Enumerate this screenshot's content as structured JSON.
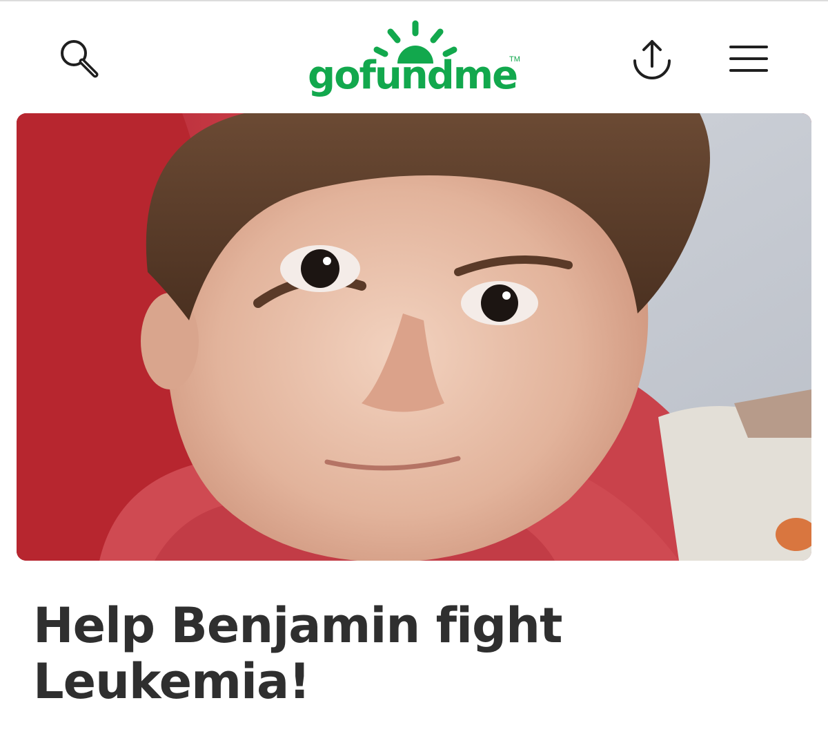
{
  "header": {
    "logo_text": "gofundme",
    "logo_tm": "TM",
    "brand_color": "#12a84d",
    "icons": {
      "search": "search-icon",
      "share": "share-icon",
      "menu": "menu-icon"
    }
  },
  "campaign": {
    "title": "Help Benjamin fight Leukemia!",
    "image_subject": "boy-portrait-photo"
  },
  "colors": {
    "title_text": "#2f2f2f",
    "background": "#ffffff"
  }
}
